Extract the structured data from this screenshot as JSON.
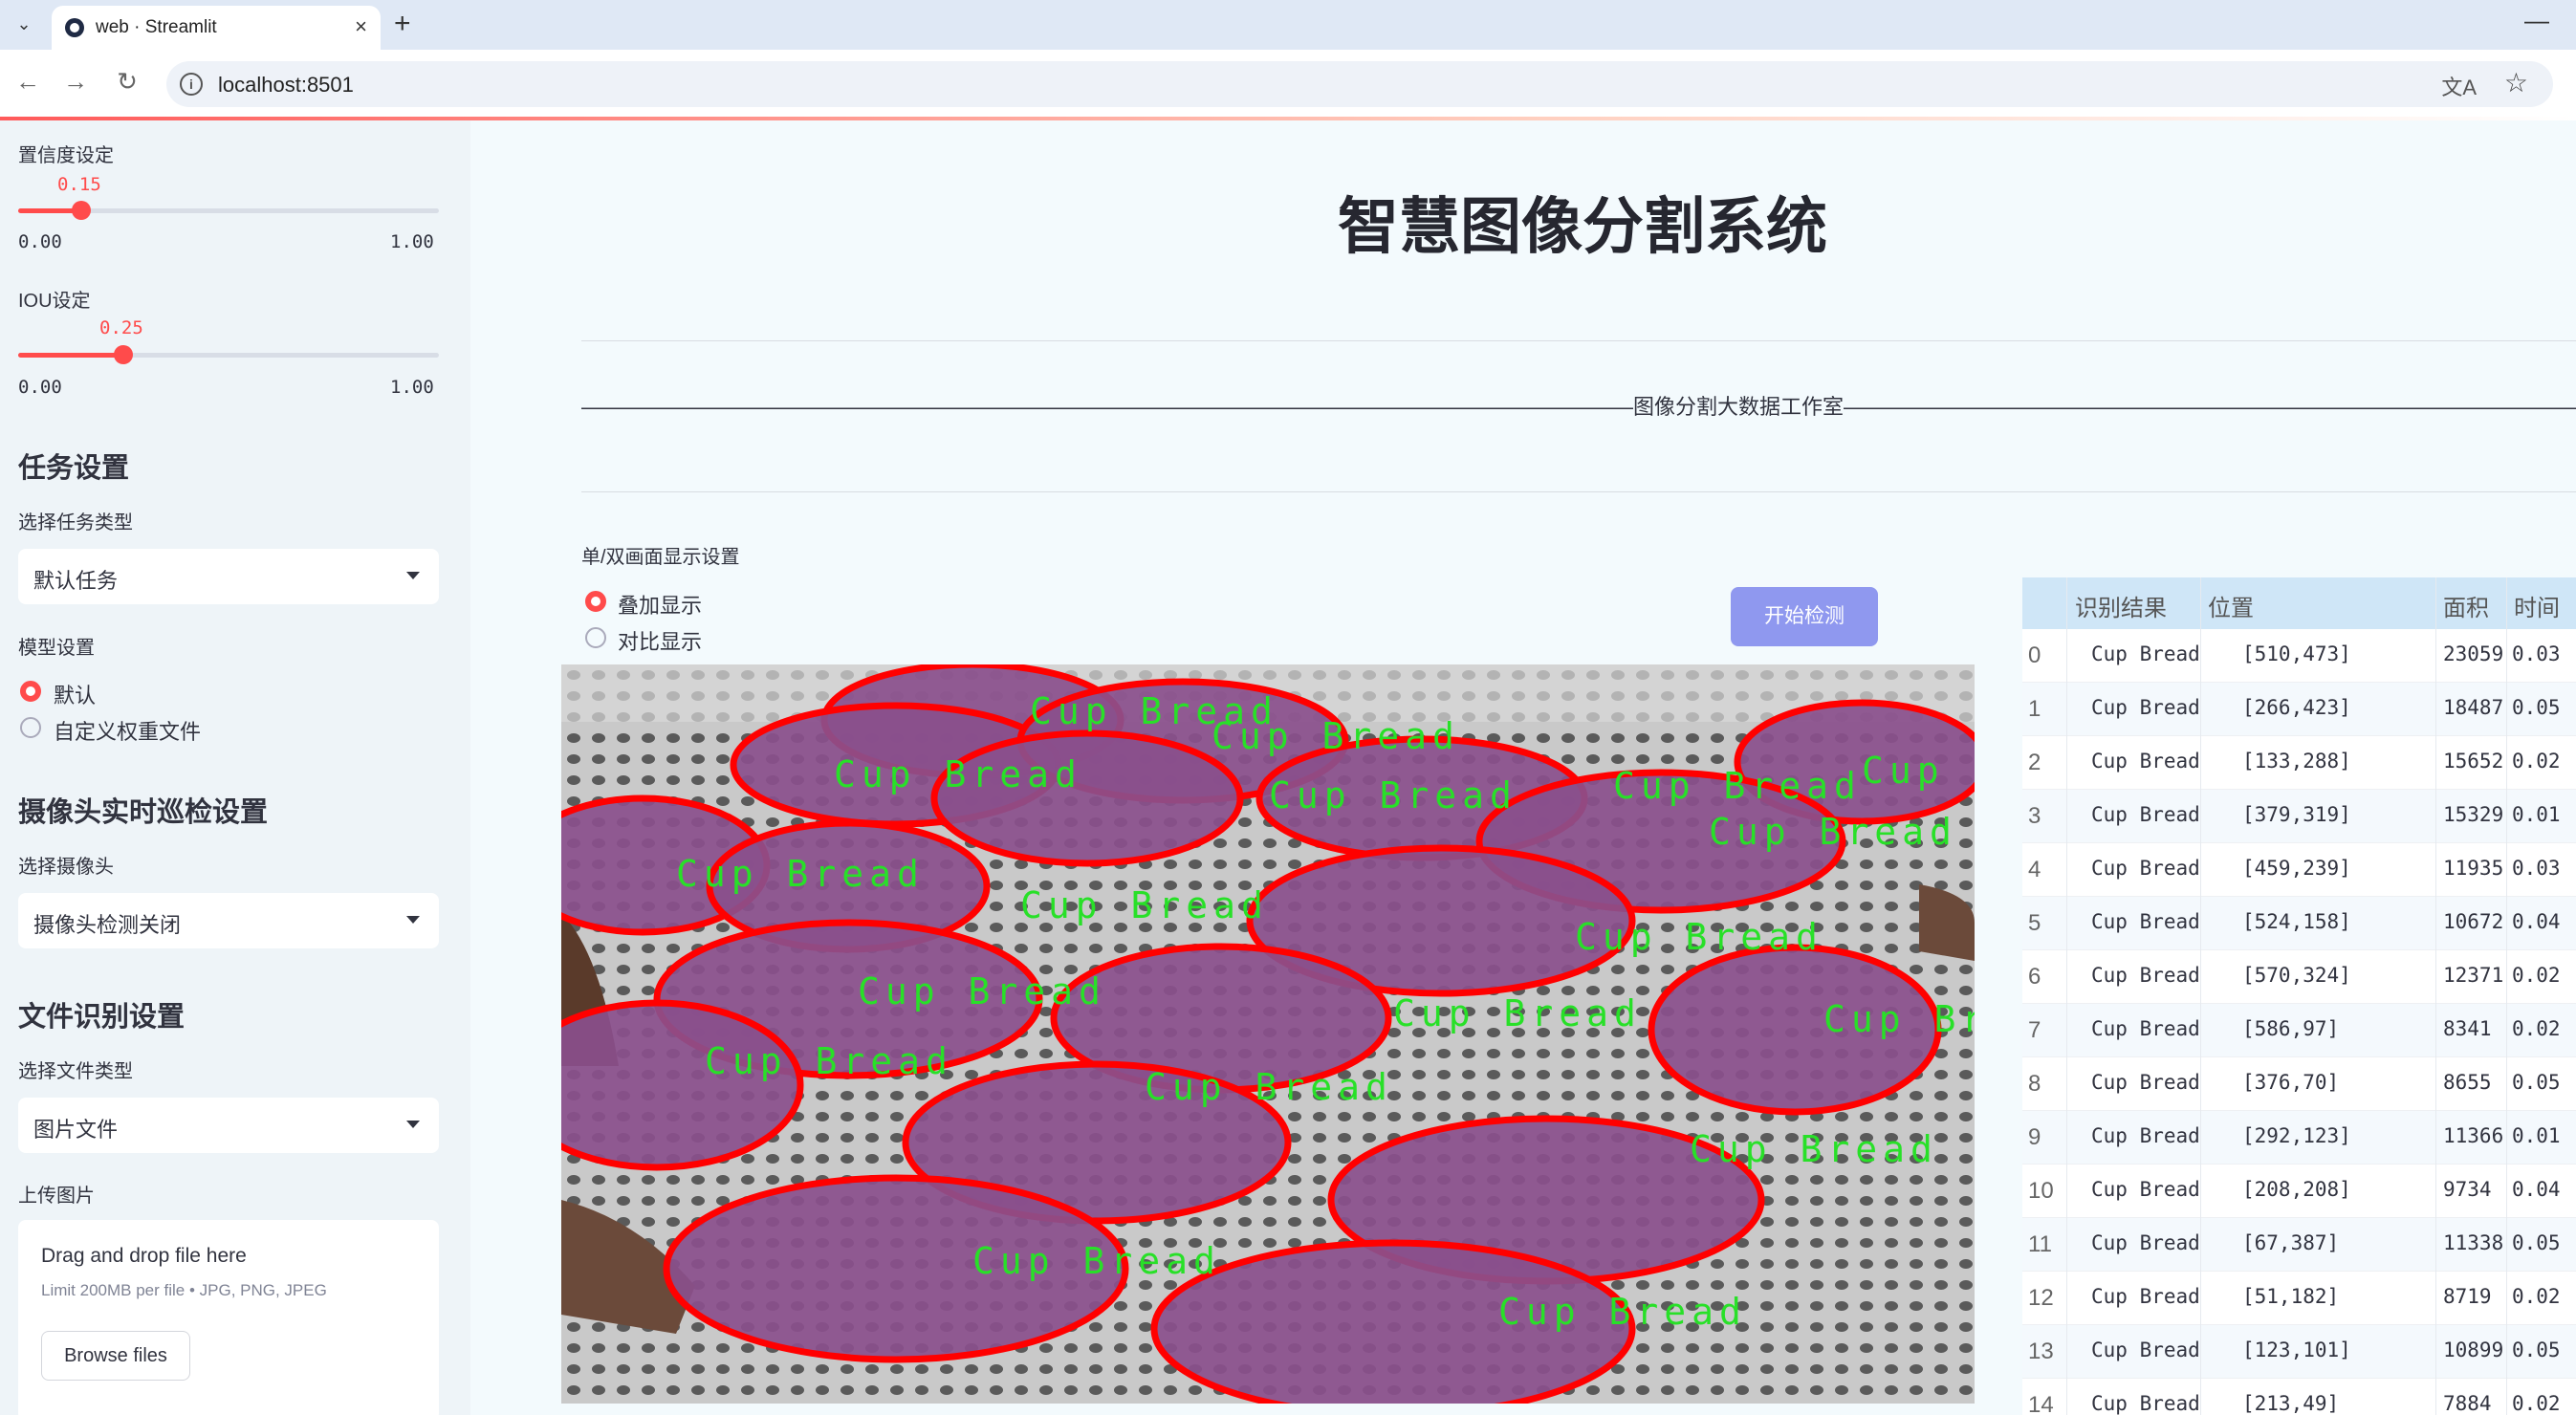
{
  "browser": {
    "tab_title": "web · Streamlit",
    "url": "localhost:8501"
  },
  "sidebar": {
    "confidence": {
      "label": "置信度设定",
      "value": "0.15",
      "min": "0.00",
      "max": "1.00",
      "fraction": 0.15
    },
    "iou": {
      "label": "IOU设定",
      "value": "0.25",
      "min": "0.00",
      "max": "1.00",
      "fraction": 0.25
    },
    "task_heading": "任务设置",
    "task_type_label": "选择任务类型",
    "task_type_value": "默认任务",
    "model_label": "模型设置",
    "model_options": [
      "默认",
      "自定义权重文件"
    ],
    "camera_heading": "摄像头实时巡检设置",
    "camera_label": "选择摄像头",
    "camera_value": "摄像头检测关闭",
    "file_heading": "文件识别设置",
    "file_type_label": "选择文件类型",
    "file_type_value": "图片文件",
    "upload_label": "上传图片",
    "upload_title": "Drag and drop file here",
    "upload_limit": "Limit 200MB per file • JPG, PNG, JPEG",
    "browse_label": "Browse files"
  },
  "main": {
    "title": "智慧图像分割系统",
    "studio_dashes_left": "——————————————————————————————————————————————————",
    "studio_name": "图像分割大数据工作室",
    "studio_dashes_right": "——————————————————————————————————————————————————",
    "display_label": "单/双画面显示设置",
    "display_options": [
      "叠加显示",
      "对比显示"
    ],
    "start_button": "开始检测",
    "segment_label": "Cup Bread"
  },
  "table": {
    "headers": [
      "识别结果",
      "位置",
      "面积",
      "时间"
    ],
    "rows": [
      [
        "0",
        "Cup Bread",
        "[510,473]",
        "23059",
        "0.03"
      ],
      [
        "1",
        "Cup Bread",
        "[266,423]",
        "18487",
        "0.05"
      ],
      [
        "2",
        "Cup Bread",
        "[133,288]",
        "15652",
        "0.02"
      ],
      [
        "3",
        "Cup Bread",
        "[379,319]",
        "15329",
        "0.01"
      ],
      [
        "4",
        "Cup Bread",
        "[459,239]",
        "11935",
        "0.03"
      ],
      [
        "5",
        "Cup Bread",
        "[524,158]",
        "10672",
        "0.04"
      ],
      [
        "6",
        "Cup Bread",
        "[570,324]",
        "12371",
        "0.02"
      ],
      [
        "7",
        "Cup Bread",
        "[586,97]",
        "8341",
        "0.02"
      ],
      [
        "8",
        "Cup Bread",
        "[376,70]",
        "8655",
        "0.05"
      ],
      [
        "9",
        "Cup Bread",
        "[292,123]",
        "11366",
        "0.01"
      ],
      [
        "10",
        "Cup Bread",
        "[208,208]",
        "9734",
        "0.04"
      ],
      [
        "11",
        "Cup Bread",
        "[67,387]",
        "11338",
        "0.05"
      ],
      [
        "12",
        "Cup Bread",
        "[51,182]",
        "8719",
        "0.02"
      ],
      [
        "13",
        "Cup Bread",
        "[123,101]",
        "10899",
        "0.05"
      ],
      [
        "14",
        "Cup Bread",
        "[213,49]",
        "7884",
        "0.02"
      ]
    ]
  },
  "colors": {
    "accent": "#ff4b4b",
    "mask_outline": "#ff0000",
    "label": "#28e028",
    "button": "#8f98ef"
  }
}
